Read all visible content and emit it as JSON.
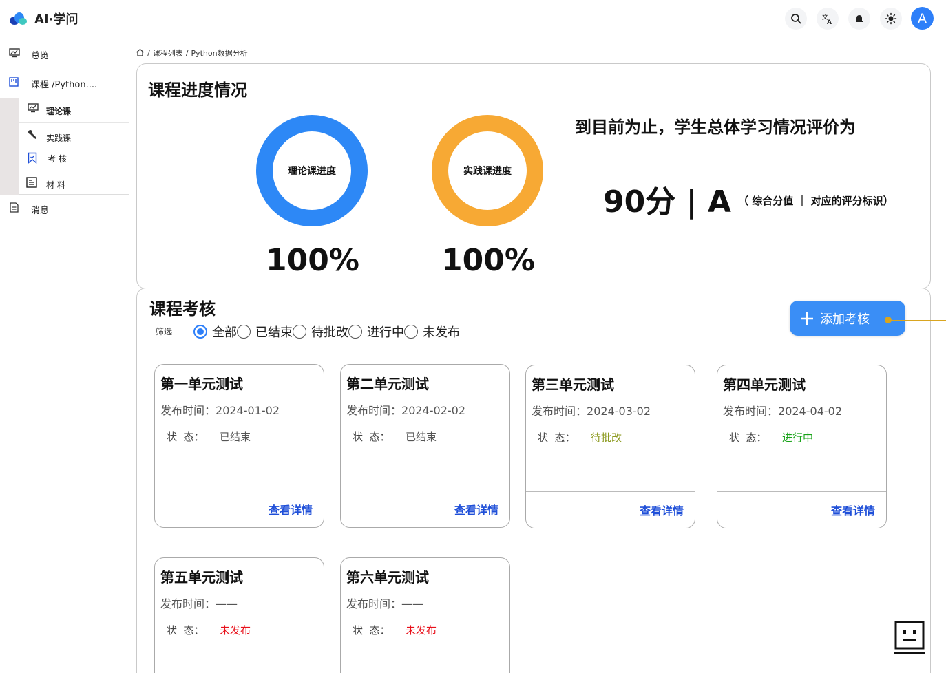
{
  "app": {
    "title": "AI·学问"
  },
  "header": {
    "icons": [
      "search-icon",
      "translate-icon",
      "bell-icon",
      "theme-icon"
    ],
    "avatar_letter": "A",
    "accent": "#2d7ff9"
  },
  "sidebar": {
    "overview": "总览",
    "course": "课程 /Python....",
    "sub_items": [
      {
        "label": "理论课",
        "icon": "chart-icon"
      },
      {
        "label": "实践课",
        "icon": "wrench-icon"
      },
      {
        "label": "考 核",
        "icon": "bookmark-icon"
      },
      {
        "label": "材 料",
        "icon": "document-icon"
      }
    ],
    "messages": "消息"
  },
  "breadcrumb": {
    "sep": "/",
    "items": [
      "课程列表",
      "Python数据分析"
    ]
  },
  "progress": {
    "title": "课程进度情况",
    "rings": [
      {
        "label": "理论课进度",
        "percent": "100%",
        "value": 1.0,
        "color": "#2d88f6"
      },
      {
        "label": "实践课进度",
        "percent": "100%",
        "value": 1.0,
        "color": "#f7a934"
      }
    ],
    "summary": "到目前为止，学生总体学习情况评价为",
    "score": "90分 | A",
    "score_note": "（ 综合分值 ｜ 对应的评分标识）"
  },
  "assessments": {
    "title": "课程考核",
    "filter_label": "筛选",
    "filters": [
      {
        "label": "全部",
        "checked": true
      },
      {
        "label": "已结束",
        "checked": false
      },
      {
        "label": "待批改",
        "checked": false
      },
      {
        "label": "进行中",
        "checked": false
      },
      {
        "label": "未发布",
        "checked": false
      }
    ],
    "add_button": "添加考核",
    "publish_prefix": "发布时间：",
    "status_prefix": "状  态：",
    "detail_link": "查看详情",
    "cards": [
      {
        "title": "第一单元测试",
        "date": "2024-01-02",
        "status": "已结束",
        "status_color": "#555555"
      },
      {
        "title": "第二单元测试",
        "date": "2024-02-02",
        "status": "已结束",
        "status_color": "#555555"
      },
      {
        "title": "第三单元测试",
        "date": "2024-03-02",
        "status": "待批改",
        "status_color": "#8c9a1f"
      },
      {
        "title": "第四单元测试",
        "date": "2024-04-02",
        "status": "进行中",
        "status_color": "#18a318"
      },
      {
        "title": "第五单元测试",
        "date": "——",
        "status": "未发布",
        "status_color": "#e8101a"
      },
      {
        "title": "第六单元测试",
        "date": "——",
        "status": "未发布",
        "status_color": "#e8101a"
      }
    ]
  }
}
